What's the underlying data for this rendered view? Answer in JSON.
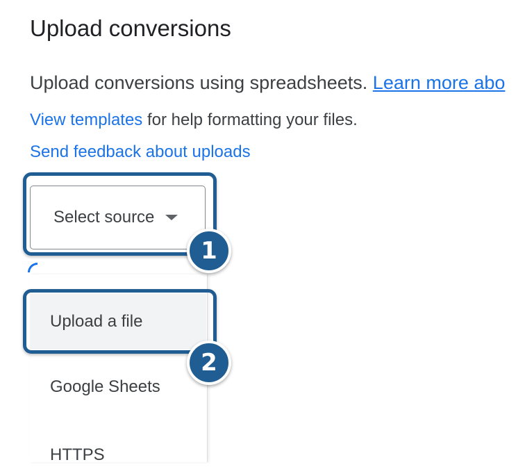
{
  "page": {
    "title": "Upload conversions"
  },
  "intro": {
    "text": "Upload conversions using spreadsheets. ",
    "learn_more": "Learn more abo"
  },
  "templates": {
    "link": "View templates",
    "rest": " for help formatting your files."
  },
  "feedback": {
    "link": "Send feedback about uploads"
  },
  "select": {
    "label": "Select source",
    "icon": "chevron-down-icon"
  },
  "menu": {
    "items": [
      {
        "label": "Upload a file"
      },
      {
        "label": "Google Sheets"
      },
      {
        "label": "HTTPS"
      }
    ]
  },
  "annotations": {
    "badges": [
      "1",
      "2"
    ],
    "color": "#1f5d93"
  }
}
